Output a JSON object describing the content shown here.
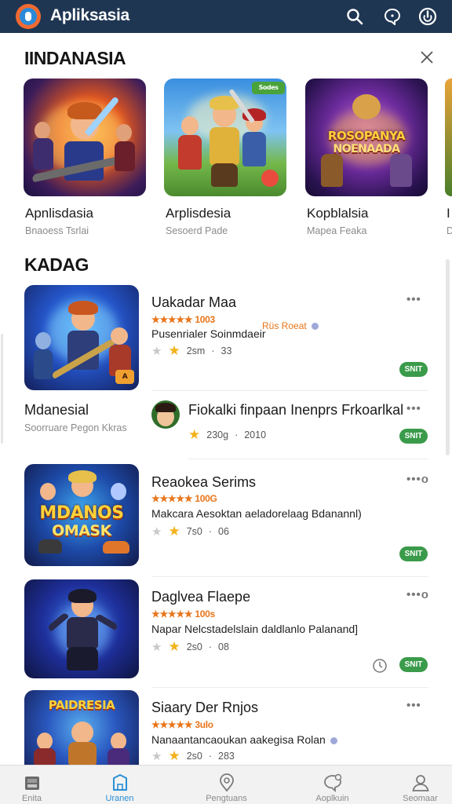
{
  "header": {
    "app_title": "Apliksasia",
    "logo_icon": "app-logo-icon",
    "icons": [
      "search-icon",
      "chat-icon",
      "power-icon"
    ]
  },
  "featured": {
    "title": "IINDANASIA",
    "close_icon": "close-icon",
    "items": [
      {
        "name": "Apnlisdasia",
        "sub": "Bnaoess Tsrlai"
      },
      {
        "name": "Arplisdesia",
        "sub": "Sesoerd Pade"
      },
      {
        "name": "Kopblalsia",
        "sub": "Mapea Feaka"
      }
    ],
    "edge_letter": "I",
    "edge_sub": "D",
    "art_texts": {
      "card2_badge": "Sodes",
      "card3_line1": "ROSOPANYA",
      "card3_line2": "NOENAADA"
    }
  },
  "list": {
    "title": "KADAG",
    "rows": [
      {
        "title": "Uakadar Maa",
        "rating": "★★★★★ 1003",
        "promo": "Rüs Roeat",
        "desc": "Pusenrialer Soinmdaeir",
        "meta_a": "2sm",
        "meta_b": "33",
        "action": "SNIT",
        "art_label": "A"
      },
      {
        "title": "Mdanesial",
        "sub": "Soorruare Pegon Kkras",
        "secondary_title": "Fiokalki finpaan Inenprs Frkoarlkal",
        "meta_a": "230g",
        "meta_b": "2010",
        "action": "SNIT"
      },
      {
        "title": "Reaokea Serims",
        "rating": "★★★★★ 100G",
        "desc": "Makcara Aesoktan aeladorelaag Bdanannl)",
        "meta_a": "7s0",
        "meta_b": "06",
        "action": "SNIT",
        "more": "•••o",
        "art_line1": "MDANOS",
        "art_line2": "OMASK"
      },
      {
        "title": "Daglvea Flaepe",
        "rating": "★★★★★ 100s",
        "desc": "Napar Nelcstadelslain daldlanlo Palanand]",
        "meta_a": "2s0",
        "meta_b": "08",
        "action": "SNIT",
        "more": "•••o"
      },
      {
        "title": "Siaary Der Rnjos",
        "rating": "★★★★★ 3ulo",
        "desc": "Nanaantancaoukan aakegisa Rolan",
        "meta_a": "2s0",
        "meta_b": "283",
        "art_line1": "PAIDRESIA"
      }
    ]
  },
  "bottom_nav": [
    {
      "label": "Enita",
      "icon": "store-icon"
    },
    {
      "label": "Uranen",
      "icon": "home-icon",
      "active": true
    },
    {
      "label": "Pengtuans",
      "icon": "location-icon"
    },
    {
      "label": "Aoplkuin",
      "icon": "chat-icon"
    },
    {
      "label": "Seomaar",
      "icon": "user-icon"
    }
  ],
  "colors": {
    "header_bg": "#1f3653",
    "accent_orange": "#e8751a",
    "accent_green": "#3a9b4a",
    "nav_active": "#2a8fd6"
  }
}
